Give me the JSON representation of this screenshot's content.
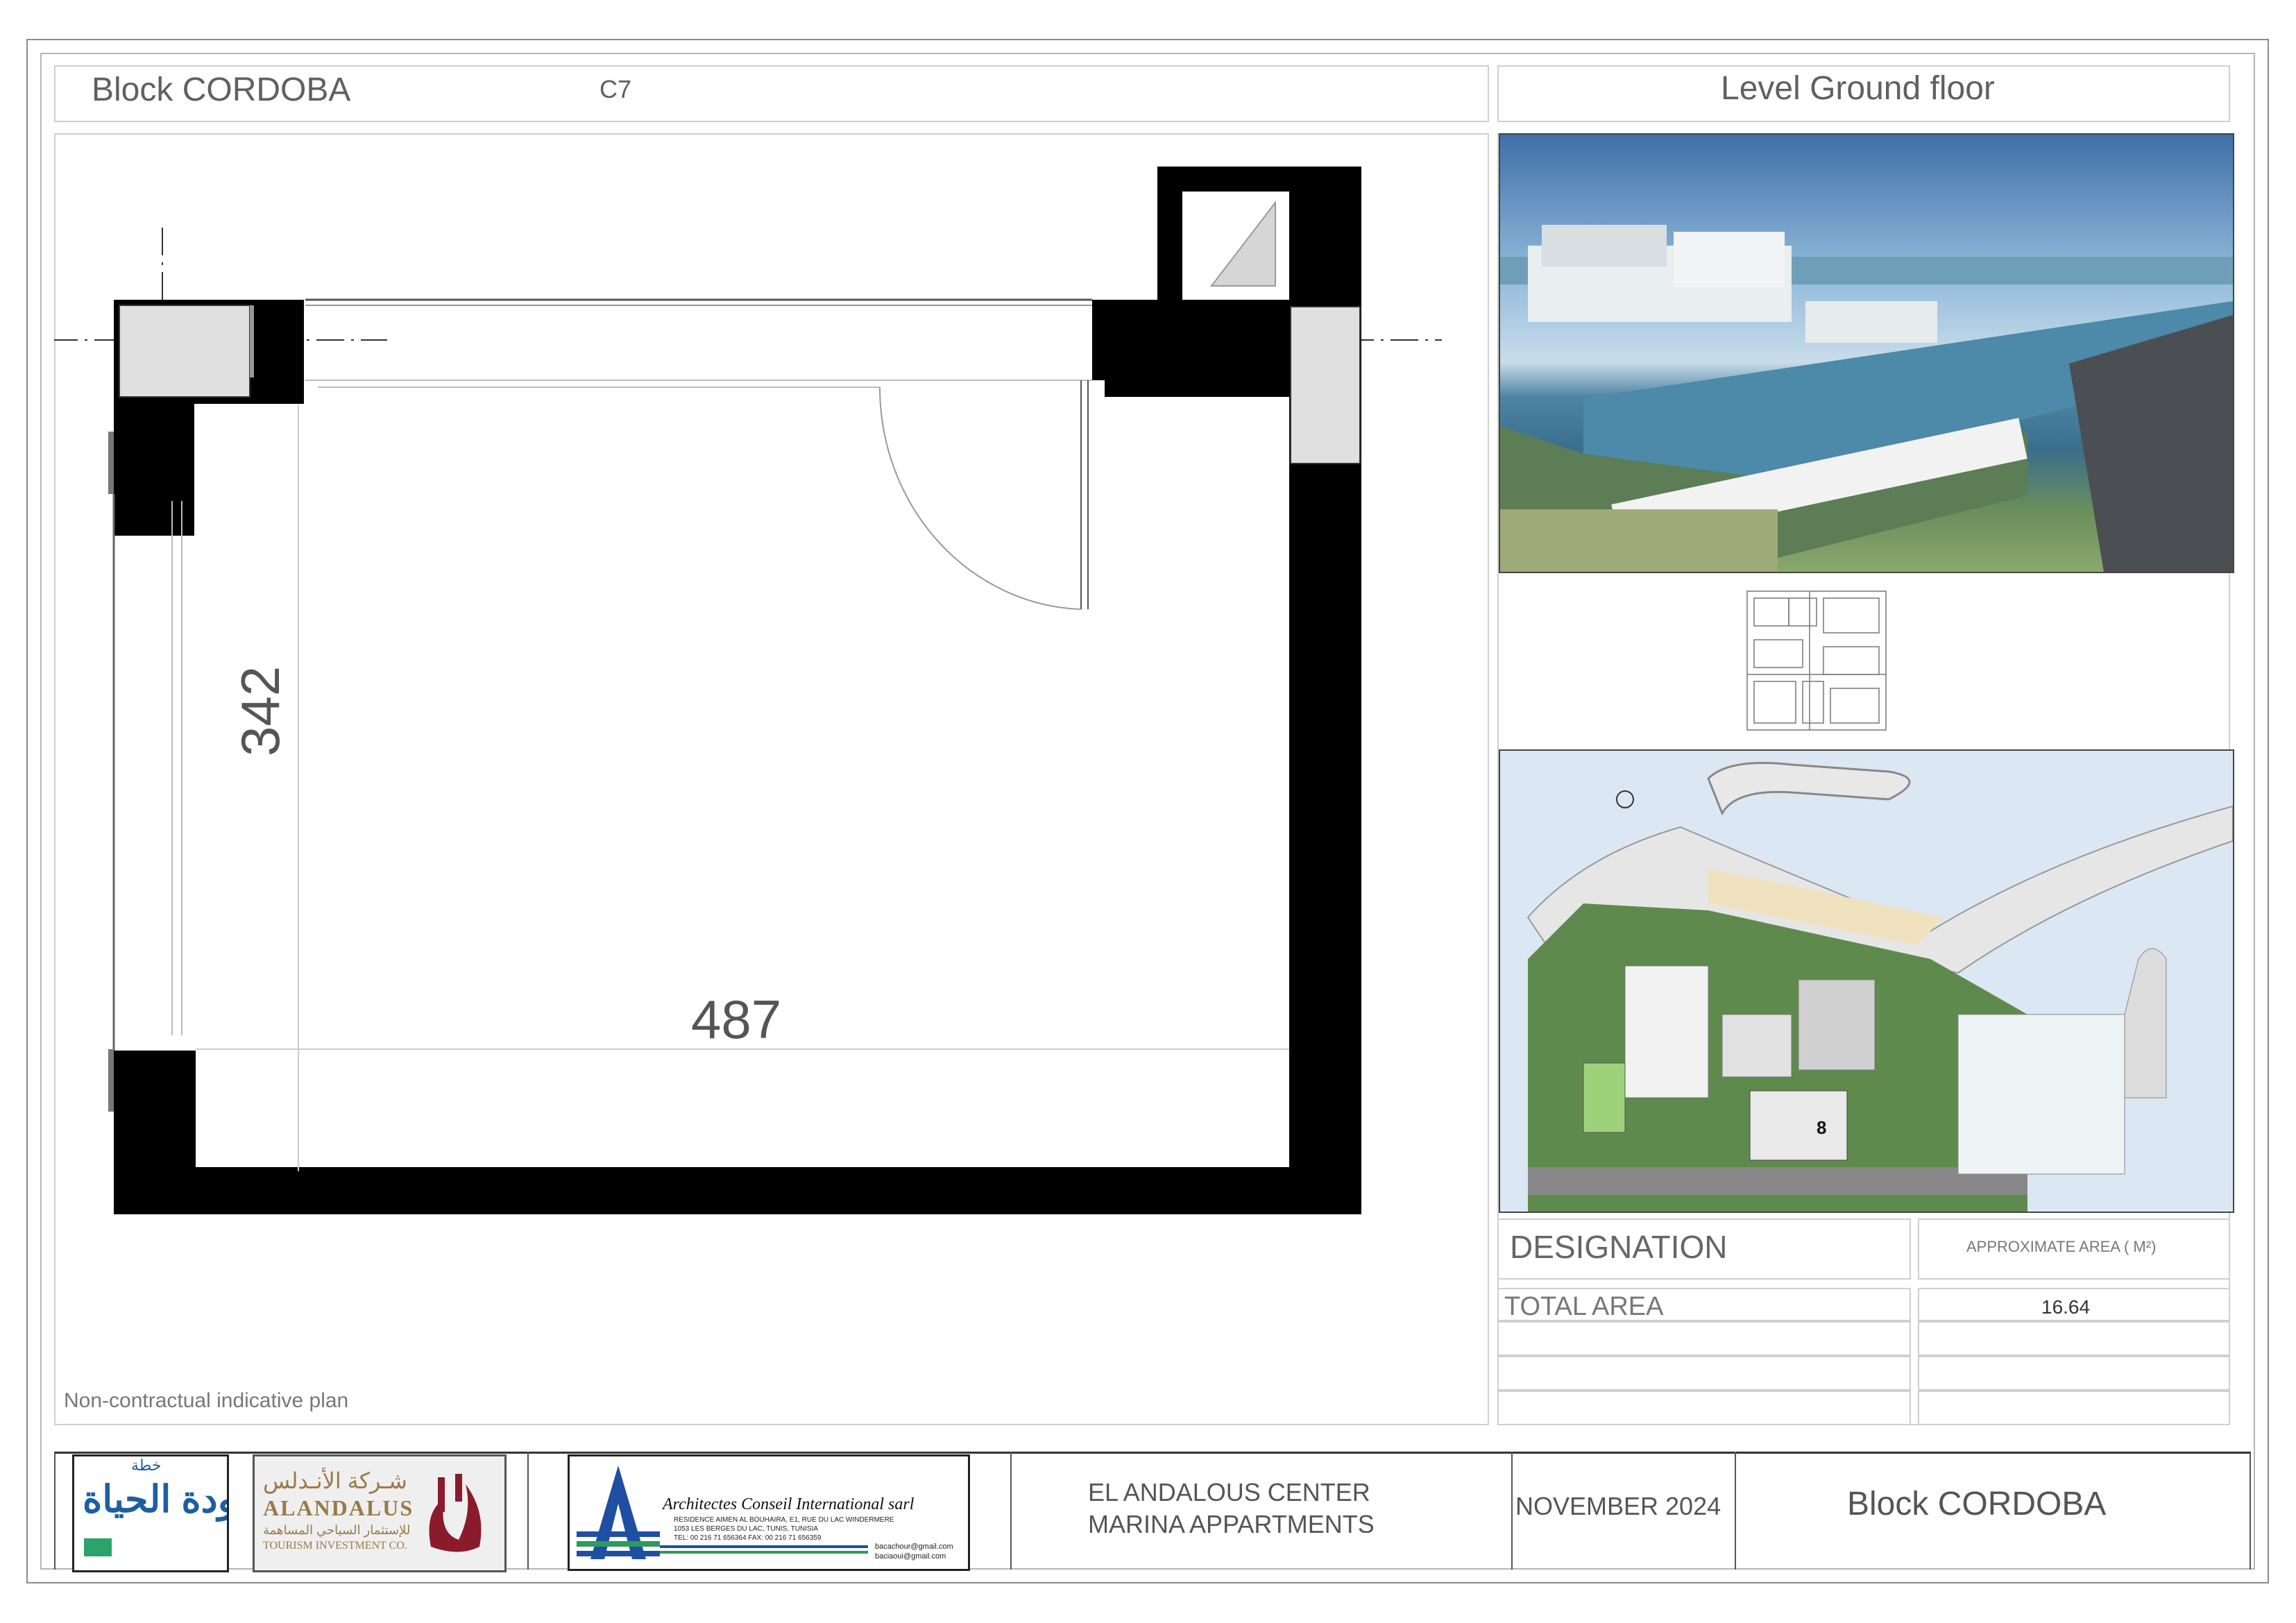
{
  "header": {
    "block": "Block CORDOBA",
    "unit": "C7",
    "level": "Level Ground floor"
  },
  "plan": {
    "dim_height": "342",
    "dim_width": "487",
    "note": "Non-contractual indicative plan"
  },
  "area_table": {
    "designation_label": "DESIGNATION",
    "area_label": "APPROXIMATE AREA  ( M²)",
    "row_label": "TOTAL AREA",
    "row_value": "16.64"
  },
  "site_plan": {
    "building_number": "8"
  },
  "footer": {
    "logo1_text_top": "خطة",
    "logo1_text_main": "عودة الحياة",
    "logo2_arabic": "شـركة الأنـدلس",
    "logo2_name": "ALANDALUS",
    "logo2_arabic_sub": "للإستثمار السياحي المساهمة",
    "logo2_sub": "TOURISM INVESTMENT CO.",
    "logo3_company": "Architectes  Conseil  International sarl",
    "logo3_address1": "RESIDENCE AIMEN AL BOUHAIRA, E1, RUE DU LAC WINDERMERE",
    "logo3_address2": "1053 LES BERGES DU LAC, TUNIS, TUNISIA",
    "logo3_phone": "TEL: 00 216 71 656364   FAX: 00 216 71 656359",
    "logo3_email1": "bacachour@gmail.com",
    "logo3_email2": "baciaoui@gmail.com",
    "project_line1": "EL ANDALOUS CENTER",
    "project_line2": "MARINA APPARTMENTS",
    "date": "NOVEMBER 2024",
    "block": "Block  CORDOBA"
  }
}
